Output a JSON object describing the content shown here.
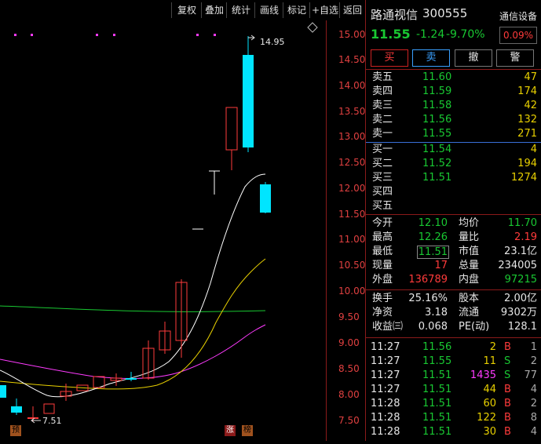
{
  "toolbar": {
    "items": [
      "复权",
      "叠加",
      "统计",
      "画线",
      "标记",
      "+自选",
      "返回"
    ]
  },
  "chart": {
    "price_labels": [
      "15.00",
      "14.50",
      "14.00",
      "13.50",
      "13.00",
      "12.50",
      "12.00",
      "11.50",
      "11.00",
      "10.50",
      "10.00",
      "9.50",
      "9.00",
      "8.50",
      "8.00",
      "7.50"
    ],
    "high_annotation": "14.95",
    "low_annotation": "7.51",
    "marker_pre": "预",
    "marker_zhang": "涨",
    "marker_bang": "榜",
    "colors": {
      "up": "#ff3b3b",
      "down": "#00e5ff",
      "ma5": "#ffffff",
      "ma10": "#e8d000",
      "ma20": "#ff3bff",
      "ma60": "#19c832",
      "dots": "#ff3bff"
    }
  },
  "stock": {
    "name": "路通视信",
    "code": "300555",
    "sector": "通信设备",
    "price": "11.55",
    "change": "-1.24",
    "change_pct": "-9.70%",
    "sector_pct": "0.09%"
  },
  "buttons": {
    "buy": "买",
    "sell": "卖",
    "cancel": "撤",
    "alert": "警"
  },
  "asks": [
    {
      "label": "卖五",
      "price": "11.60",
      "vol": "47"
    },
    {
      "label": "卖四",
      "price": "11.59",
      "vol": "174"
    },
    {
      "label": "卖三",
      "price": "11.58",
      "vol": "42"
    },
    {
      "label": "卖二",
      "price": "11.56",
      "vol": "132"
    },
    {
      "label": "卖一",
      "price": "11.55",
      "vol": "271"
    }
  ],
  "bids": [
    {
      "label": "买一",
      "price": "11.54",
      "vol": "4"
    },
    {
      "label": "买二",
      "price": "11.52",
      "vol": "194"
    },
    {
      "label": "买三",
      "price": "11.51",
      "vol": "1274"
    },
    {
      "label": "买四",
      "price": "",
      "vol": ""
    },
    {
      "label": "买五",
      "price": "",
      "vol": ""
    }
  ],
  "stats": {
    "open_label": "今开",
    "open": "12.10",
    "avg_label": "均价",
    "avg": "11.70",
    "high_label": "最高",
    "high": "12.26",
    "vr_label": "量比",
    "vr": "2.19",
    "low_label": "最低",
    "low": "11.51",
    "mcap_label": "市值",
    "mcap": "23.1亿",
    "cur_label": "现量",
    "cur": "17",
    "total_label": "总量",
    "total": "234005",
    "out_label": "外盘",
    "out": "136789",
    "in_label": "内盘",
    "in": "97215",
    "turn_label": "换手",
    "turn": "25.16%",
    "shares_label": "股本",
    "shares": "2.00亿",
    "nav_label": "净资",
    "nav": "3.18",
    "float_label": "流通",
    "float": "9302万",
    "eps_label": "收益㈢",
    "eps": "0.068",
    "pe_label": "PE(动)",
    "pe": "128.1"
  },
  "ticks": [
    {
      "time": "11:27",
      "price": "11.56",
      "vol": "2",
      "side": "B",
      "n": "1"
    },
    {
      "time": "11:27",
      "price": "11.55",
      "vol": "11",
      "side": "S",
      "n": "2"
    },
    {
      "time": "11:27",
      "price": "11.51",
      "vol": "1435",
      "side": "S",
      "n": "77"
    },
    {
      "time": "11:27",
      "price": "11.51",
      "vol": "44",
      "side": "B",
      "n": "4"
    },
    {
      "time": "11:28",
      "price": "11.51",
      "vol": "60",
      "side": "B",
      "n": "2"
    },
    {
      "time": "11:28",
      "price": "11.51",
      "vol": "122",
      "side": "B",
      "n": "8"
    },
    {
      "time": "11:28",
      "price": "11.51",
      "vol": "30",
      "side": "B",
      "n": "4"
    }
  ]
}
